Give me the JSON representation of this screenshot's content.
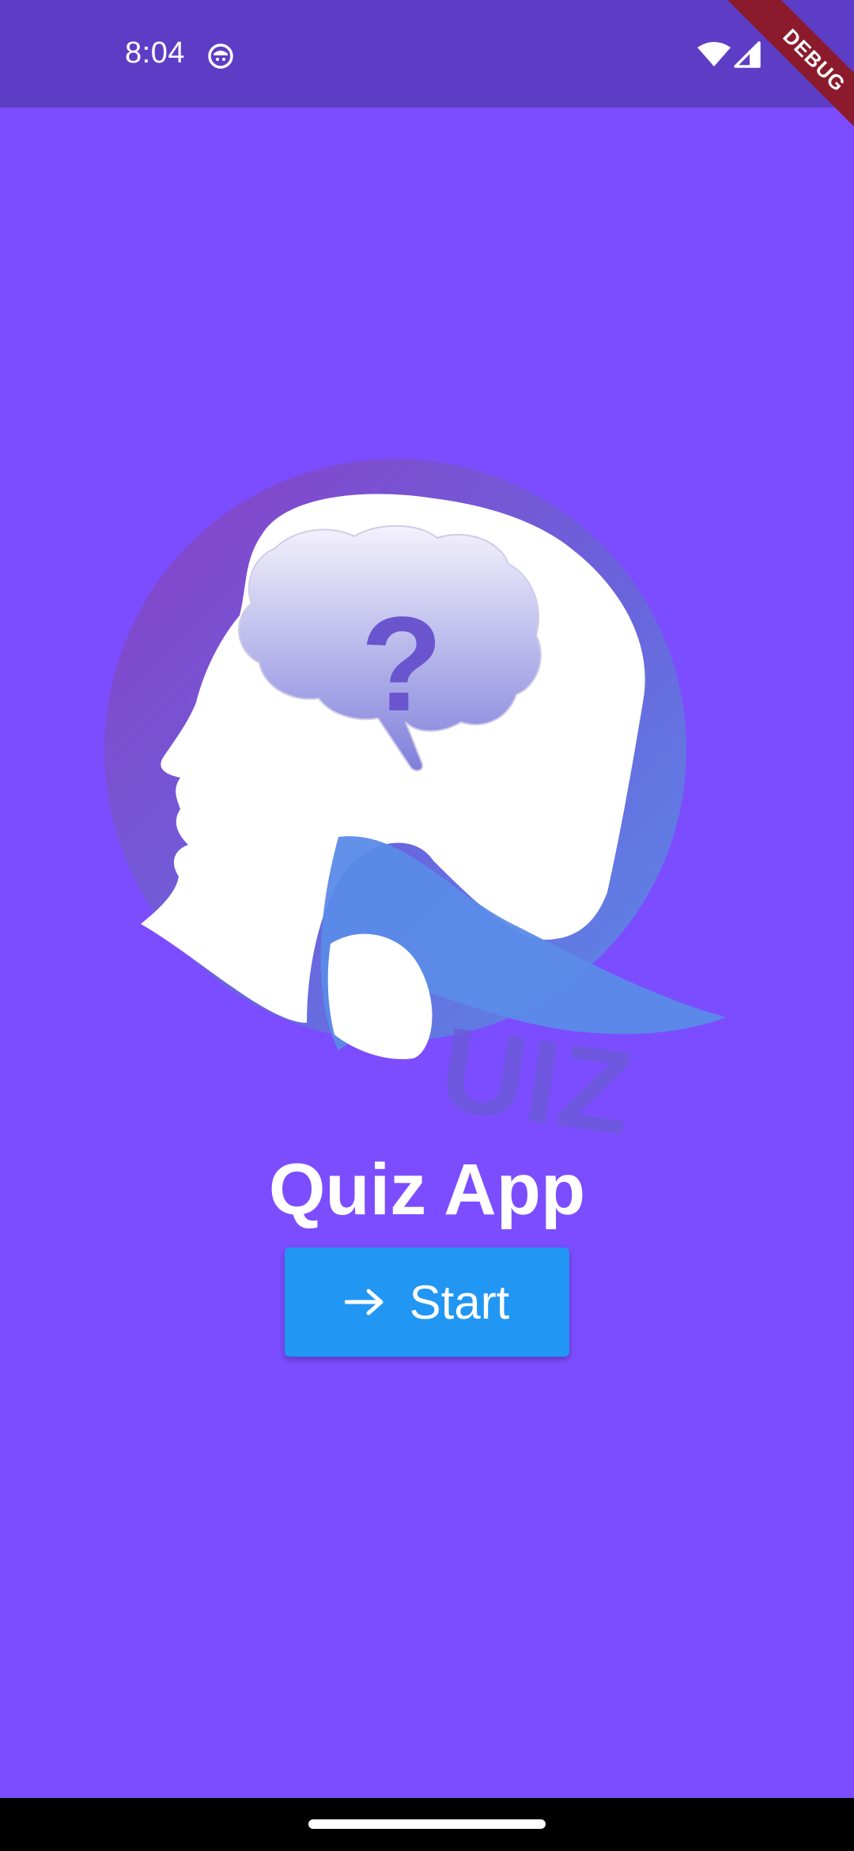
{
  "status_bar": {
    "time": "8:04",
    "icons": [
      "app-notification-icon",
      "wifi-icon",
      "signal-icon"
    ]
  },
  "debug_banner": "DEBUG",
  "logo": {
    "question_mark": "?",
    "wordmark": "UIZ"
  },
  "main": {
    "title": "Quiz App",
    "start_button_label": "Start",
    "start_button_icon": "arrow-forward-icon"
  },
  "colors": {
    "background": "#7c4dff",
    "status_bar": "#5e3dc6",
    "button": "#2196f3",
    "debug_ribbon": "#8b1a2d"
  }
}
